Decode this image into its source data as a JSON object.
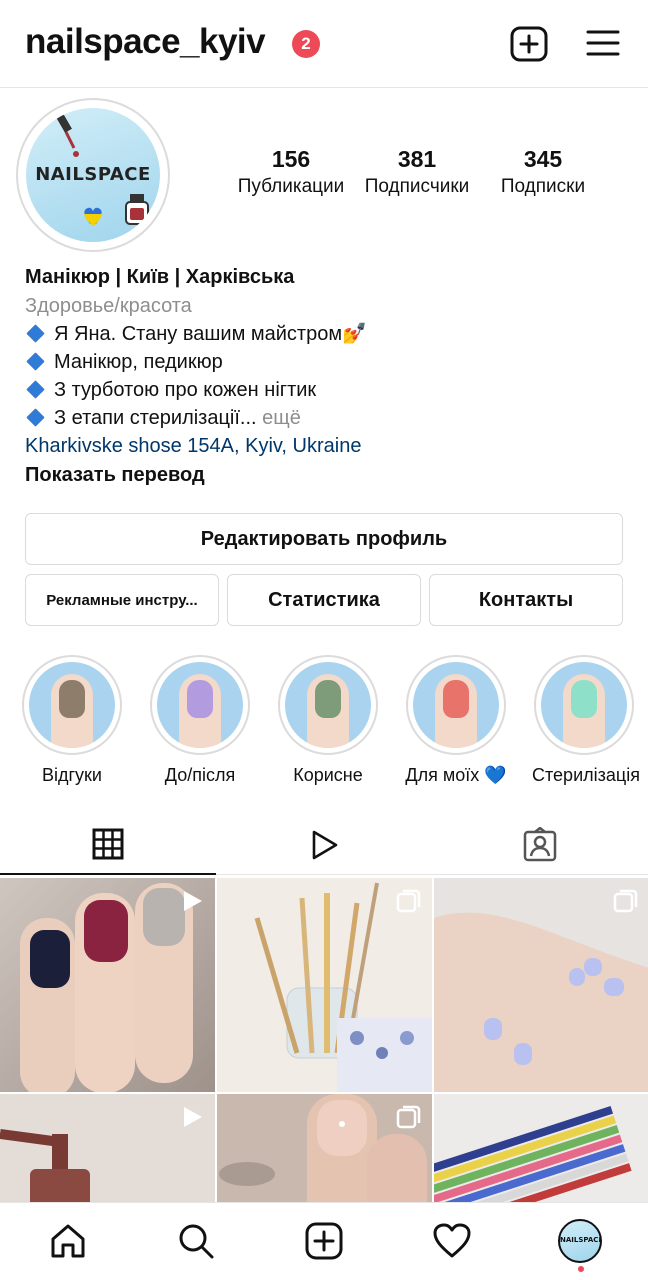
{
  "header": {
    "username": "nailspace_kyiv",
    "notification_count": "2"
  },
  "avatar": {
    "logo_text": "NAILSPACE"
  },
  "stats": [
    {
      "value": "156",
      "label": "Публикации"
    },
    {
      "value": "381",
      "label": "Подписчики"
    },
    {
      "value": "345",
      "label": "Подписки"
    }
  ],
  "bio": {
    "name": "Манікюр | Київ | Харківська",
    "category": "Здоровье/красота",
    "lines": [
      "Я Яна. Стану вашим майстром💅",
      "Манікюр, педикюр",
      "З турботою про кожен нігтик",
      "З етапи стерилізації..."
    ],
    "more": "ещё",
    "location": "Kharkivske shose 154A, Kyiv, Ukraine",
    "translate": "Показать перевод"
  },
  "buttons": {
    "edit_profile": "Редактировать профиль",
    "ads_tools": "Рекламные инстру...",
    "statistics": "Статистика",
    "contacts": "Контакты"
  },
  "highlights": [
    {
      "label": "Відгуки",
      "nail_color": "#8f7d6c"
    },
    {
      "label": "До/після",
      "nail_color": "#b39be0"
    },
    {
      "label": "Корисне",
      "nail_color": "#7f9c7a"
    },
    {
      "label": "Для моїх 💙",
      "nail_color": "#e8736b"
    },
    {
      "label": "Стерилізація",
      "nail_color": "#8fe0c8"
    }
  ],
  "tabs": [
    {
      "name": "grid-icon",
      "active": true
    },
    {
      "name": "reels-icon",
      "active": false
    },
    {
      "name": "tagged-icon",
      "active": false
    }
  ],
  "colors": {
    "badge": "#ed4956",
    "link": "#00376b",
    "secondary_text": "#8e8e8e",
    "border": "#dbdbdb"
  }
}
